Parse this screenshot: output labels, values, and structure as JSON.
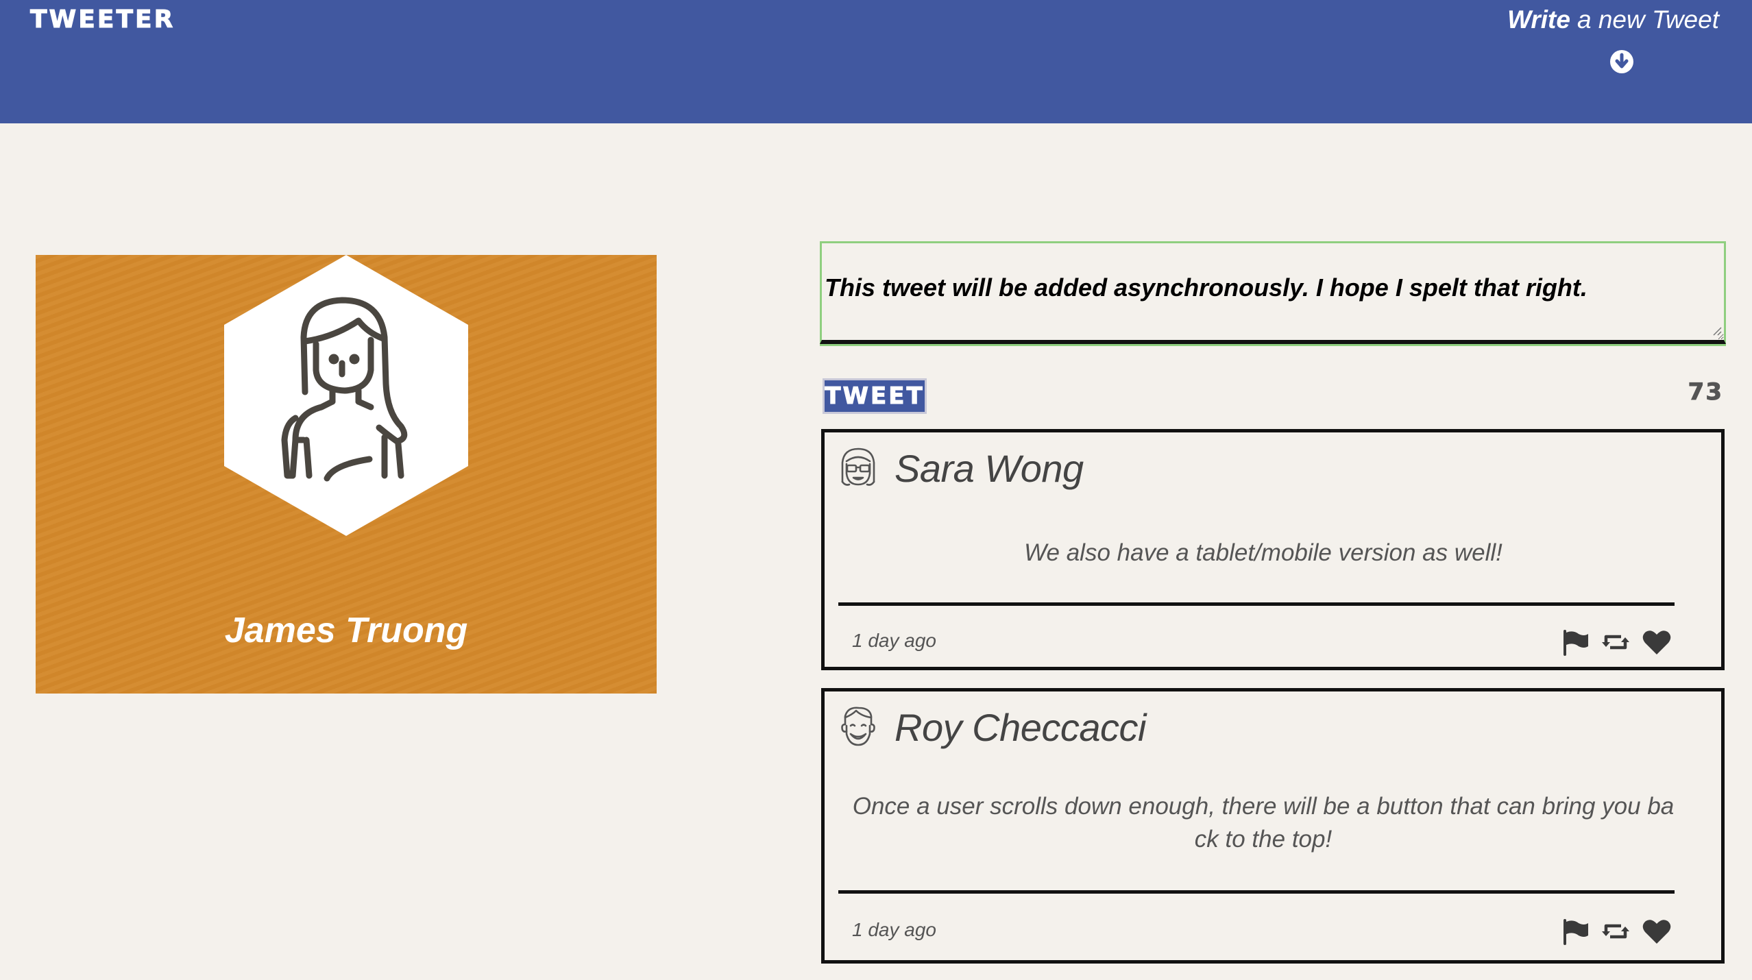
{
  "nav": {
    "logo": "TWEETER",
    "compose_bold": "Write",
    "compose_rest": "a new Tweet",
    "compose_icon": "arrow-circle-down-icon"
  },
  "colors": {
    "nav_bg": "#4158a0",
    "page_bg": "#f4f1ec",
    "profile_bg": "#d4892b",
    "textarea_focus": "#8fcf7f",
    "text_dark": "#111111",
    "text_gray": "#555555"
  },
  "profile": {
    "name": "James Truong",
    "avatar_icon": "woman-avatar-icon"
  },
  "compose": {
    "textarea_value": "This tweet will be added asynchronously. I hope I spelt that right.",
    "button_label": "TWEET",
    "char_count": "73"
  },
  "tweets": [
    {
      "author": "Sara Wong",
      "avatar_icon": "woman-glasses-avatar-icon",
      "content": "We also have a tablet/mobile version as well!",
      "time": "1 day ago",
      "actions": [
        "flag-icon",
        "retweet-icon",
        "heart-icon"
      ]
    },
    {
      "author": "Roy Checcacci",
      "avatar_icon": "man-smiling-avatar-icon",
      "content": "Once a user scrolls down enough, there will be a button that can bring you ba ck to the top!",
      "time": "1 day ago",
      "actions": [
        "flag-icon",
        "retweet-icon",
        "heart-icon"
      ]
    }
  ]
}
